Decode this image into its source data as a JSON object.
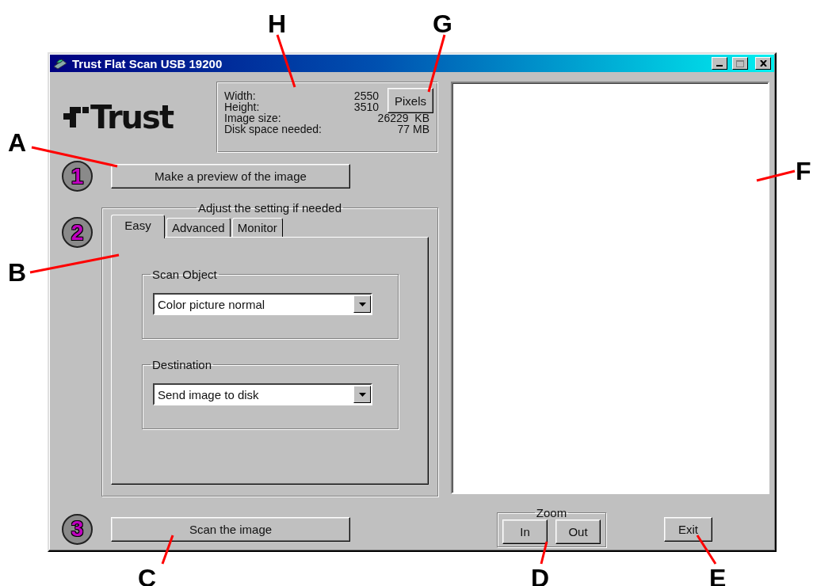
{
  "window": {
    "title": "Trust Flat Scan USB 19200"
  },
  "logo": {
    "text": "Trust"
  },
  "image_info": {
    "rows": [
      {
        "label": "Width:",
        "value": "2550"
      },
      {
        "label": "Height:",
        "value": "3510"
      },
      {
        "label": "Image size:",
        "value": "26229  KB"
      },
      {
        "label": "Disk space needed:",
        "value": "77 MB"
      }
    ],
    "unit_button": "Pixels"
  },
  "steps": [
    {
      "number": "1",
      "button": "Make a preview of the image"
    },
    {
      "number": "2",
      "group_title": "Adjust the setting if needed",
      "tabs": [
        {
          "label": "Easy",
          "selected": true
        },
        {
          "label": "Advanced",
          "selected": false
        },
        {
          "label": "Monitor",
          "selected": false
        }
      ],
      "groups": [
        {
          "title": "Scan Object",
          "value": "Color picture normal"
        },
        {
          "title": "Destination",
          "value": "Send image to disk"
        }
      ]
    },
    {
      "number": "3",
      "button": "Scan the image"
    }
  ],
  "zoom": {
    "title": "Zoom",
    "buttons": [
      "In",
      "Out"
    ]
  },
  "exit_button": "Exit",
  "callouts": [
    {
      "letter": "A"
    },
    {
      "letter": "B"
    },
    {
      "letter": "C"
    },
    {
      "letter": "D"
    },
    {
      "letter": "E"
    },
    {
      "letter": "F"
    },
    {
      "letter": "G"
    },
    {
      "letter": "H"
    }
  ]
}
